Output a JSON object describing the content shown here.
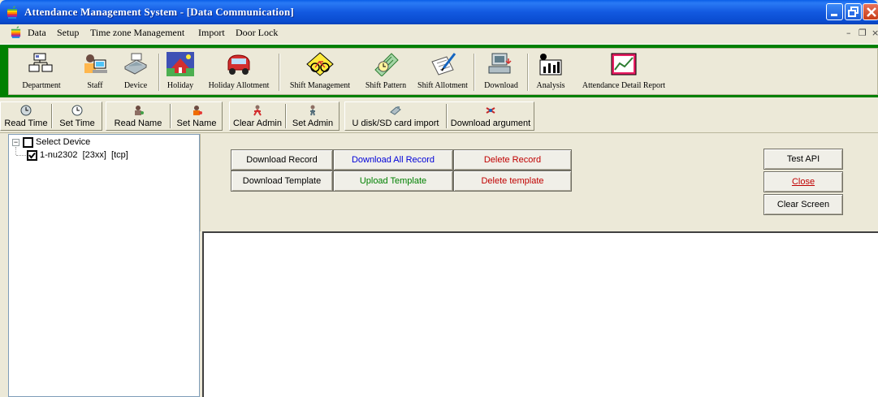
{
  "window": {
    "title": "Attendance Management System - [Data Communication]"
  },
  "menu": {
    "items": [
      "Data",
      "Setup",
      "Time zone Management",
      "Import",
      "Door Lock"
    ]
  },
  "toolbar": {
    "buttons": [
      {
        "label": "Department",
        "icon": "department-icon"
      },
      {
        "label": "Staff",
        "icon": "staff-icon"
      },
      {
        "label": "Device",
        "icon": "device-icon"
      },
      {
        "label": "Holiday",
        "icon": "holiday-icon"
      },
      {
        "label": "Holiday Allotment",
        "icon": "holiday-allotment-icon"
      },
      {
        "label": "Shift Management",
        "icon": "shift-management-icon"
      },
      {
        "label": "Shift Pattern",
        "icon": "shift-pattern-icon"
      },
      {
        "label": "Shift Allotment",
        "icon": "shift-allotment-icon"
      },
      {
        "label": "Download",
        "icon": "download-icon"
      },
      {
        "label": "Analysis",
        "icon": "analysis-icon"
      },
      {
        "label": "Attendance Detail Report",
        "icon": "report-icon"
      }
    ]
  },
  "comm_toolbar": {
    "buttons": [
      {
        "label": "Read Time",
        "icon": "clock-read-icon"
      },
      {
        "label": "Set Time",
        "icon": "clock-set-icon"
      },
      {
        "label": "Read Name",
        "icon": "read-name-icon"
      },
      {
        "label": "Set Name",
        "icon": "set-name-icon"
      },
      {
        "label": "Clear Admin",
        "icon": "clear-admin-icon"
      },
      {
        "label": "Set Admin",
        "icon": "set-admin-icon"
      },
      {
        "label": "U disk/SD card import",
        "icon": "udisk-icon"
      },
      {
        "label": "Download argument",
        "icon": "download-argument-icon"
      }
    ]
  },
  "tree": {
    "root_label": "Select Device",
    "root_expander": "−",
    "child_label": "1-nu2302  [23xx]  [tcp]",
    "child_checked": true
  },
  "commands": {
    "download_record": "Download Record",
    "download_all_record": "Download All Record",
    "delete_record": "Delete Record",
    "download_template": "Download Template",
    "upload_template": "Upload Template",
    "delete_template": "Delete template",
    "test_api": "Test API",
    "close": "Close",
    "clear_screen": "Clear Screen"
  },
  "colors": {
    "titlebar": "#0a5ee8",
    "toolbar_border": "#008000",
    "blue_text": "#0000d8",
    "green_text": "#008000",
    "red_text": "#c00000"
  }
}
